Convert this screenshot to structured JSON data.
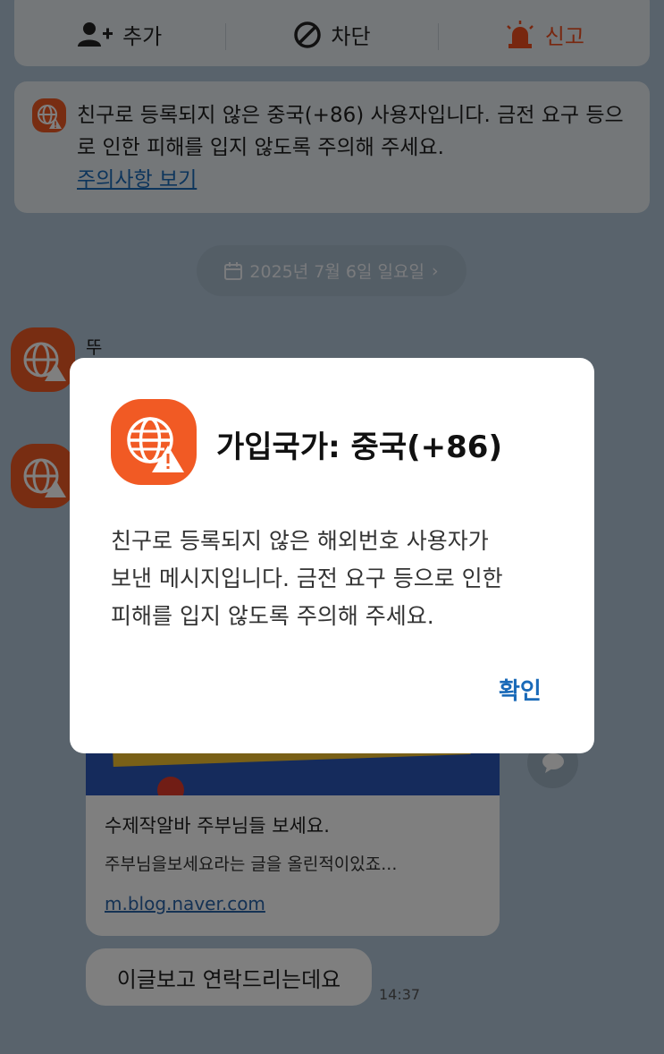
{
  "action_bar": {
    "add_label": "추가",
    "block_label": "차단",
    "report_label": "신고"
  },
  "warning": {
    "text": "친구로 등록되지 않은 중국(+86) 사용자입니다. 금전 요구 등으로 인한 피해를 입지 않도록 주의해 주세요.",
    "link": "주의사항 보기"
  },
  "chat": {
    "date": "2025년 7월 6일 일요일",
    "sender_name": "뚜",
    "link_card": {
      "title": "수제작알바 주부님들 보세요.",
      "description": "주부님을보세요라는 글을 올린적이있죠...",
      "url": "m.blog.naver.com"
    },
    "message": "이글보고 연락드리는데요",
    "time": "14:37"
  },
  "dialog": {
    "title": "가입국가: 중국(+86)",
    "body_lines": [
      "친구로 등록되지 않은 해외번호 사용자가",
      "보낸 메시지입니다. 금전 요구 등으로 인한",
      "피해를 입지 않도록 주의해 주세요."
    ],
    "confirm_label": "확인"
  },
  "colors": {
    "accent_orange": "#f15a24",
    "link_blue": "#1a6ab8",
    "chat_background": "#b2c7d9"
  }
}
